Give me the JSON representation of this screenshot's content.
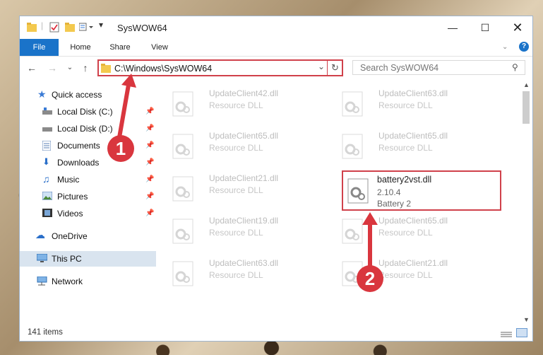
{
  "window": {
    "title": "SysWOW64"
  },
  "ribbon": {
    "tabs": [
      "File",
      "Home",
      "Share",
      "View"
    ]
  },
  "address": {
    "path": "C:\\Windows\\SysWOW64"
  },
  "search": {
    "placeholder": "Search SysWOW64"
  },
  "sidebar": {
    "items": [
      {
        "label": "Quick access"
      },
      {
        "label": "Local Disk (C:)"
      },
      {
        "label": "Local Disk (D:)"
      },
      {
        "label": "Documents"
      },
      {
        "label": "Downloads"
      },
      {
        "label": "Music"
      },
      {
        "label": "Pictures"
      },
      {
        "label": "Videos"
      },
      {
        "label": "OneDrive"
      },
      {
        "label": "This PC"
      },
      {
        "label": "Network"
      }
    ]
  },
  "files": [
    {
      "name": "UpdateClient42.dll",
      "desc": "Resource DLL"
    },
    {
      "name": "UpdateClient63.dll",
      "desc": "Resource DLL"
    },
    {
      "name": "UpdateClient65.dll",
      "desc": "Resource DLL"
    },
    {
      "name": "UpdateClient65.dll",
      "desc": "Resource DLL"
    },
    {
      "name": "UpdateClient21.dll",
      "desc": "Resource DLL"
    },
    {
      "name": "UpdateClient19.dll",
      "desc": "Resource DLL"
    },
    {
      "name": "UpdateClient65.dll",
      "desc": "Resource DLL"
    },
    {
      "name": "UpdateClient63.dll",
      "desc": "Resource DLL"
    },
    {
      "name": "UpdateClient21.dll",
      "desc": "Resource DLL"
    }
  ],
  "highlighted_file": {
    "name": "battery2vst.dll",
    "version": "2.10.4",
    "desc": "Battery 2"
  },
  "status": {
    "count": "141 items"
  },
  "annotations": {
    "step1": "1",
    "step2": "2"
  }
}
